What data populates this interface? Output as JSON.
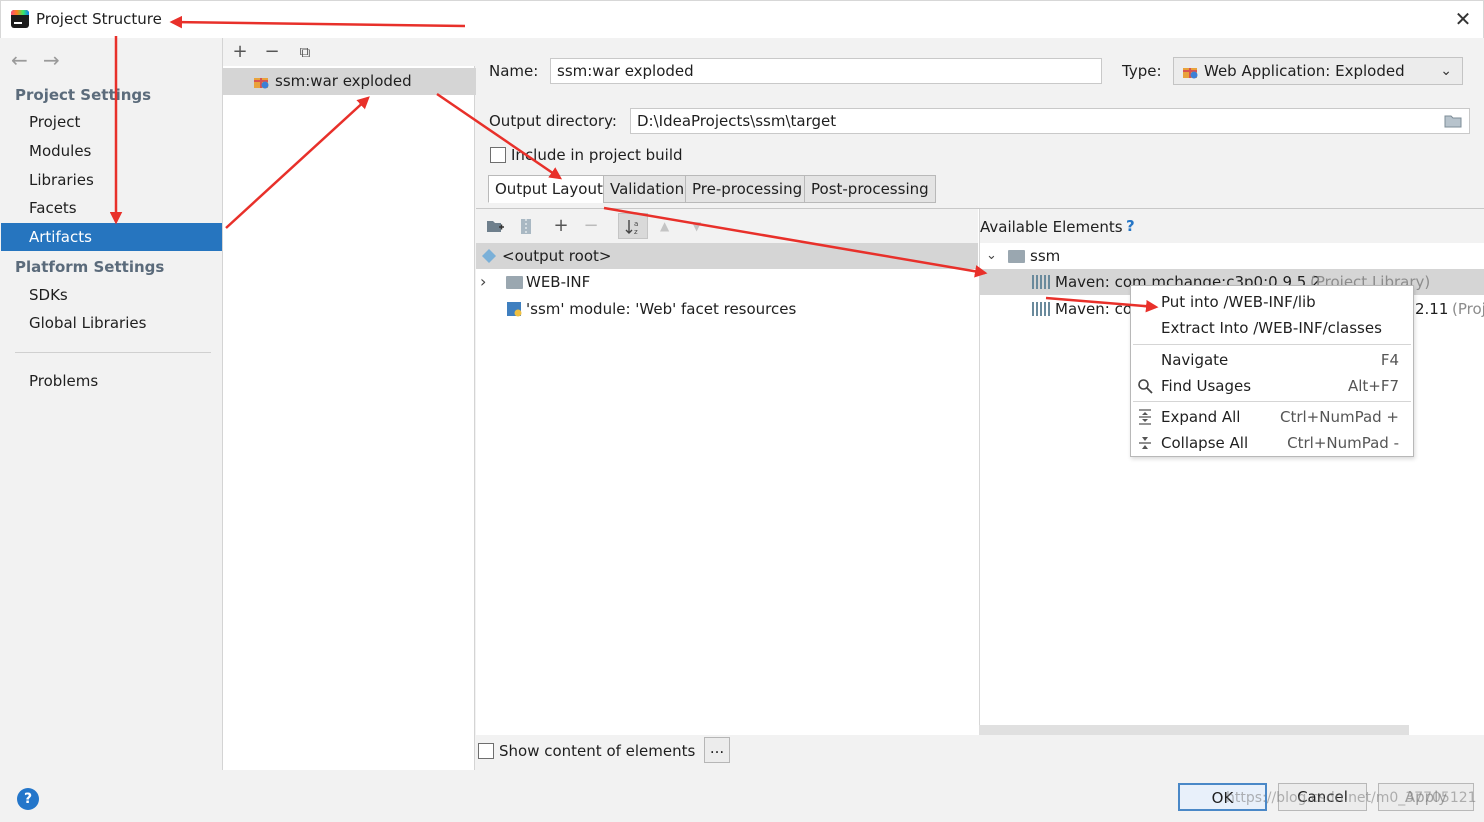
{
  "window": {
    "title": "Project Structure",
    "close_glyph": "✕"
  },
  "nav": {
    "back_glyph": "←",
    "forward_glyph": "→",
    "project_settings_header": "Project Settings",
    "project_items": [
      "Project",
      "Modules",
      "Libraries",
      "Facets",
      "Artifacts"
    ],
    "selected_item": "Artifacts",
    "platform_settings_header": "Platform Settings",
    "platform_items": [
      "SDKs",
      "Global Libraries"
    ],
    "problems": "Problems"
  },
  "artifacts_toolbar": {
    "add": "+",
    "remove": "−",
    "copy": "⧉"
  },
  "artifacts_list": [
    {
      "label": "ssm:war exploded",
      "icon": "gift-icon"
    }
  ],
  "artifact_form": {
    "name_label": "Name:",
    "name_value": "ssm:war exploded",
    "type_label": "Type:",
    "type_value": "Web Application: Exploded",
    "output_dir_label": "Output directory:",
    "output_dir_value": "D:\\IdeaProjects\\ssm\\target",
    "include_build_label": "Include in project build",
    "include_build_checked": false
  },
  "tabs": [
    "Output Layout",
    "Validation",
    "Pre-processing",
    "Post-processing"
  ],
  "selected_tab": "Output Layout",
  "layout_toolbar": {
    "add": "+",
    "remove": "−"
  },
  "output_tree": [
    {
      "label": "<output root>",
      "icon": "output-root-icon"
    },
    {
      "label": "WEB-INF",
      "icon": "folder-icon",
      "expander": "›"
    },
    {
      "label": "'ssm' module: 'Web' facet resources",
      "icon": "web-facet-icon"
    }
  ],
  "available": {
    "header": "Available Elements",
    "help_glyph": "?",
    "root": "ssm",
    "items": [
      {
        "label": "Maven: com.mchange:c3p0:0.9.5.2",
        "suffix": "(Project Library)"
      },
      {
        "label": "Maven: co",
        "tail": "2.11",
        "tail_suffix": "(Proj"
      }
    ]
  },
  "context_menu": {
    "items": [
      {
        "label": "Put into /WEB-INF/lib",
        "shortcut": ""
      },
      {
        "label": "Extract Into /WEB-INF/classes",
        "shortcut": ""
      },
      {
        "label": "Navigate",
        "shortcut": "F4"
      },
      {
        "label": "Find Usages",
        "shortcut": "Alt+F7",
        "icon": "search-icon"
      },
      {
        "label": "Expand All",
        "shortcut": "Ctrl+NumPad +",
        "icon": "expand-all-icon"
      },
      {
        "label": "Collapse All",
        "shortcut": "Ctrl+NumPad -",
        "icon": "collapse-all-icon"
      }
    ]
  },
  "show_content_label": "Show content of elements",
  "dots_label": "...",
  "footer": {
    "help": "?",
    "ok": "OK",
    "cancel": "Cancel",
    "apply": "Apply",
    "watermark": "https://blog.csdn.net/m0_37705121"
  },
  "annotation_color": "#e8302a"
}
